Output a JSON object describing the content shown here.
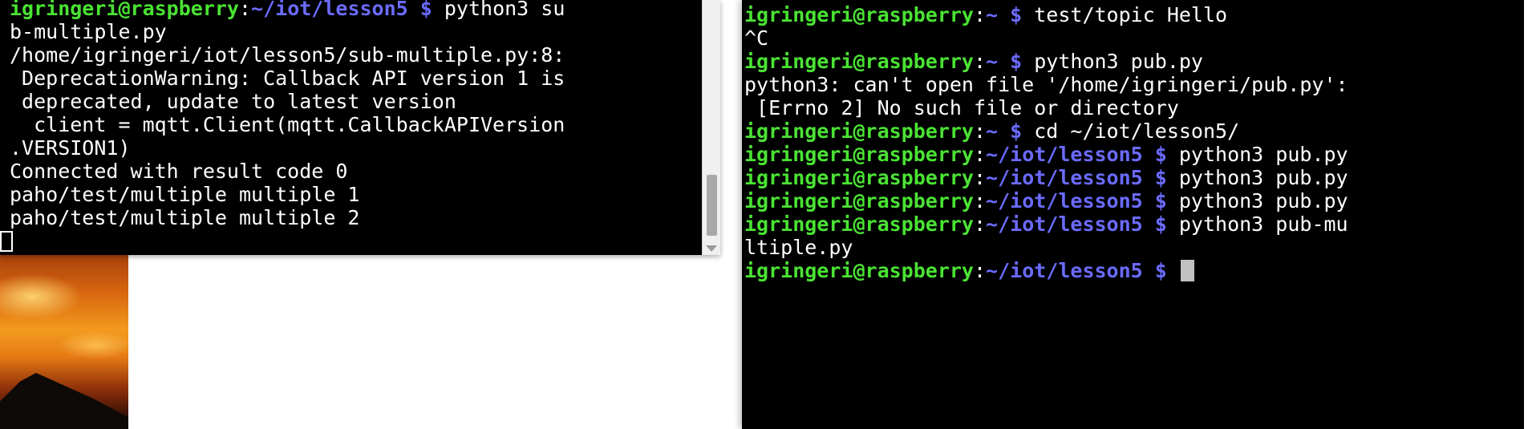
{
  "left_terminal": {
    "lines": [
      [
        {
          "c": "prompt-user",
          "t": "igringeri@raspberry"
        },
        {
          "c": "cmd",
          "t": ":"
        },
        {
          "c": "prompt-path",
          "t": "~/iot/lesson5 $"
        },
        {
          "c": "cmd",
          "t": " python3 su"
        }
      ],
      [
        {
          "c": "cmd",
          "t": "b-multiple.py"
        }
      ],
      [
        {
          "c": "cmd",
          "t": "/home/igringeri/iot/lesson5/sub-multiple.py:8:"
        }
      ],
      [
        {
          "c": "cmd",
          "t": " DeprecationWarning: Callback API version 1 is"
        }
      ],
      [
        {
          "c": "cmd",
          "t": " deprecated, update to latest version"
        }
      ],
      [
        {
          "c": "cmd",
          "t": "  client = mqtt.Client(mqtt.CallbackAPIVersion"
        }
      ],
      [
        {
          "c": "cmd",
          "t": ".VERSION1)"
        }
      ],
      [
        {
          "c": "cmd",
          "t": "Connected with result code 0"
        }
      ],
      [
        {
          "c": "cmd",
          "t": "paho/test/multiple multiple 1"
        }
      ],
      [
        {
          "c": "cmd",
          "t": "paho/test/multiple multiple 2"
        }
      ]
    ]
  },
  "right_terminal": {
    "lines": [
      [
        {
          "c": "prompt-user",
          "t": "igringeri@raspberry"
        },
        {
          "c": "cmd",
          "t": ":"
        },
        {
          "c": "prompt-path",
          "t": "~ $"
        },
        {
          "c": "cmd",
          "t": " test/topic Hello"
        }
      ],
      [
        {
          "c": "cmd",
          "t": "^C"
        }
      ],
      [
        {
          "c": "prompt-user",
          "t": "igringeri@raspberry"
        },
        {
          "c": "cmd",
          "t": ":"
        },
        {
          "c": "prompt-path",
          "t": "~ $"
        },
        {
          "c": "cmd",
          "t": " python3 pub.py"
        }
      ],
      [
        {
          "c": "cmd",
          "t": "python3: can't open file '/home/igringeri/pub.py':"
        }
      ],
      [
        {
          "c": "cmd",
          "t": " [Errno 2] No such file or directory"
        }
      ],
      [
        {
          "c": "prompt-user",
          "t": "igringeri@raspberry"
        },
        {
          "c": "cmd",
          "t": ":"
        },
        {
          "c": "prompt-path",
          "t": "~ $"
        },
        {
          "c": "cmd",
          "t": " cd ~/iot/lesson5/"
        }
      ],
      [
        {
          "c": "prompt-user",
          "t": "igringeri@raspberry"
        },
        {
          "c": "cmd",
          "t": ":"
        },
        {
          "c": "prompt-path",
          "t": "~/iot/lesson5 $"
        },
        {
          "c": "cmd",
          "t": " python3 pub.py"
        }
      ],
      [
        {
          "c": "prompt-user",
          "t": "igringeri@raspberry"
        },
        {
          "c": "cmd",
          "t": ":"
        },
        {
          "c": "prompt-path",
          "t": "~/iot/lesson5 $"
        },
        {
          "c": "cmd",
          "t": " python3 pub.py"
        }
      ],
      [
        {
          "c": "prompt-user",
          "t": "igringeri@raspberry"
        },
        {
          "c": "cmd",
          "t": ":"
        },
        {
          "c": "prompt-path",
          "t": "~/iot/lesson5 $"
        },
        {
          "c": "cmd",
          "t": " python3 pub.py"
        }
      ],
      [
        {
          "c": "prompt-user",
          "t": "igringeri@raspberry"
        },
        {
          "c": "cmd",
          "t": ":"
        },
        {
          "c": "prompt-path",
          "t": "~/iot/lesson5 $"
        },
        {
          "c": "cmd",
          "t": " python3 pub-mu"
        }
      ],
      [
        {
          "c": "cmd",
          "t": "ltiple.py"
        }
      ],
      [
        {
          "c": "prompt-user",
          "t": "igringeri@raspberry"
        },
        {
          "c": "cmd",
          "t": ":"
        },
        {
          "c": "prompt-path",
          "t": "~/iot/lesson5 $"
        },
        {
          "c": "cmd",
          "t": " "
        }
      ]
    ]
  },
  "colors": {
    "terminal_bg": "#000000",
    "prompt_user": "#4ae333",
    "prompt_path": "#6b6bff",
    "text": "#ffffff"
  }
}
